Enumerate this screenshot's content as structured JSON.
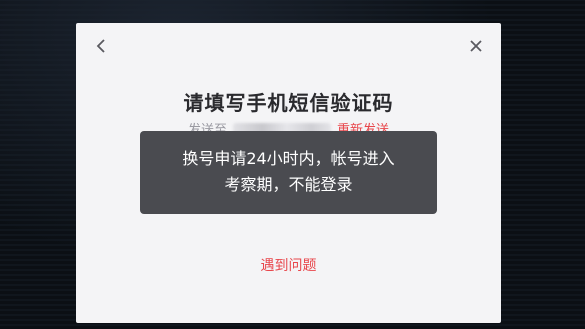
{
  "dialog": {
    "title": "请填写手机短信验证码",
    "sent_prefix": "发送至",
    "resend_label": "重新发送",
    "problem_label": "遇到问题",
    "back_icon": "chevron-left-icon",
    "close_icon": "close-icon"
  },
  "toast": {
    "line1": "换号申请24小时内，帐号进入",
    "line2": "考察期，不能登录"
  },
  "colors": {
    "accent": "#e8474c",
    "toast_bg": "#4a4b50",
    "dialog_bg": "#f4f4f6"
  }
}
